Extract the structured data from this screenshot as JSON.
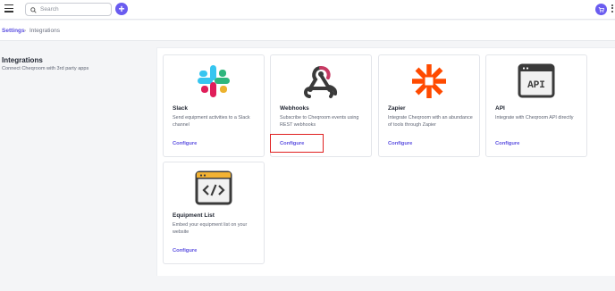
{
  "topbar": {
    "search_placeholder": "Search",
    "add_label": "+"
  },
  "breadcrumb": {
    "parent": "Settings",
    "separator": "›",
    "current": "Integrations"
  },
  "intro": {
    "title": "Integrations",
    "subtitle": "Connect Cheqroom with 3rd party apps"
  },
  "integrations": [
    {
      "name": "Slack",
      "description": "Send equipment activities to a Slack channel",
      "action": "Configure",
      "icon": "slack-logo"
    },
    {
      "name": "Webhooks",
      "description": "Subscribe to Cheqroom events using REST webhooks",
      "action": "Configure",
      "icon": "webhooks-logo"
    },
    {
      "name": "Zapier",
      "description": "Integrate Cheqroom with an abundance of tools through Zapier",
      "action": "Configure",
      "icon": "zapier-logo"
    },
    {
      "name": "API",
      "description": "Integrate with Cheqroom API directly",
      "action": "Configure",
      "icon": "api-window-icon",
      "icon_text": "API"
    },
    {
      "name": "Equipment List",
      "description": "Embed your equipment list on your website",
      "action": "Configure",
      "icon": "embed-code-window-icon"
    }
  ],
  "colors": {
    "accent": "#6a5cf0",
    "link": "#5b4fe0",
    "highlight": "#e02020"
  }
}
